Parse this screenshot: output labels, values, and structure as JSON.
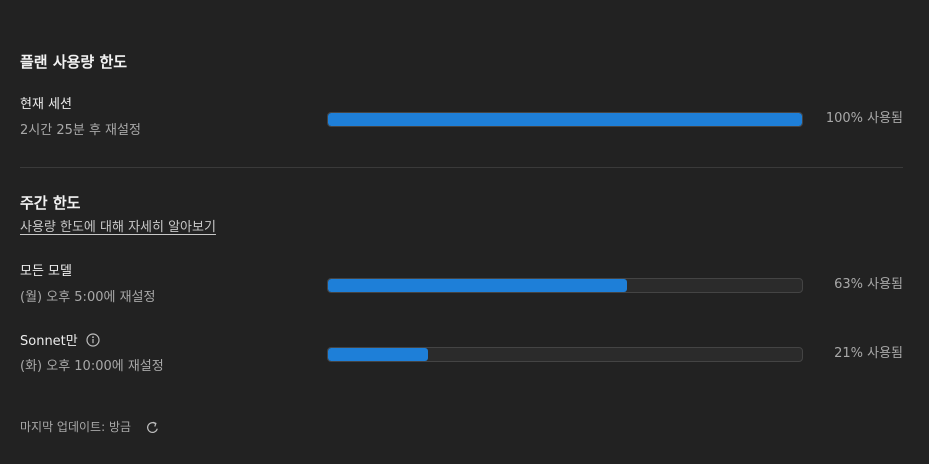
{
  "plan": {
    "title": "플랜 사용량 한도",
    "session": {
      "label": "현재 세션",
      "reset": "2시간 25분 후 재설정",
      "percent": 100,
      "percent_label": "100% 사용됨"
    }
  },
  "weekly": {
    "title": "주간 한도",
    "learn_more": "사용량 한도에 대해 자세히 알아보기",
    "rows": [
      {
        "label": "모든 모델",
        "reset": "(월) 오후 5:00에 재설정",
        "percent": 63,
        "percent_label": "63% 사용됨"
      },
      {
        "label": "Sonnet만",
        "reset": "(화) 오후 10:00에 재설정",
        "percent": 21,
        "percent_label": "21% 사용됨"
      }
    ]
  },
  "footer": {
    "last_updated": "마지막 업데이트: 방금"
  },
  "icons": {
    "info": "info-icon",
    "refresh": "refresh-icon"
  },
  "colors": {
    "background": "#222222",
    "bar_fill": "#1e7fd8",
    "bar_track": "#2b2b2b"
  }
}
